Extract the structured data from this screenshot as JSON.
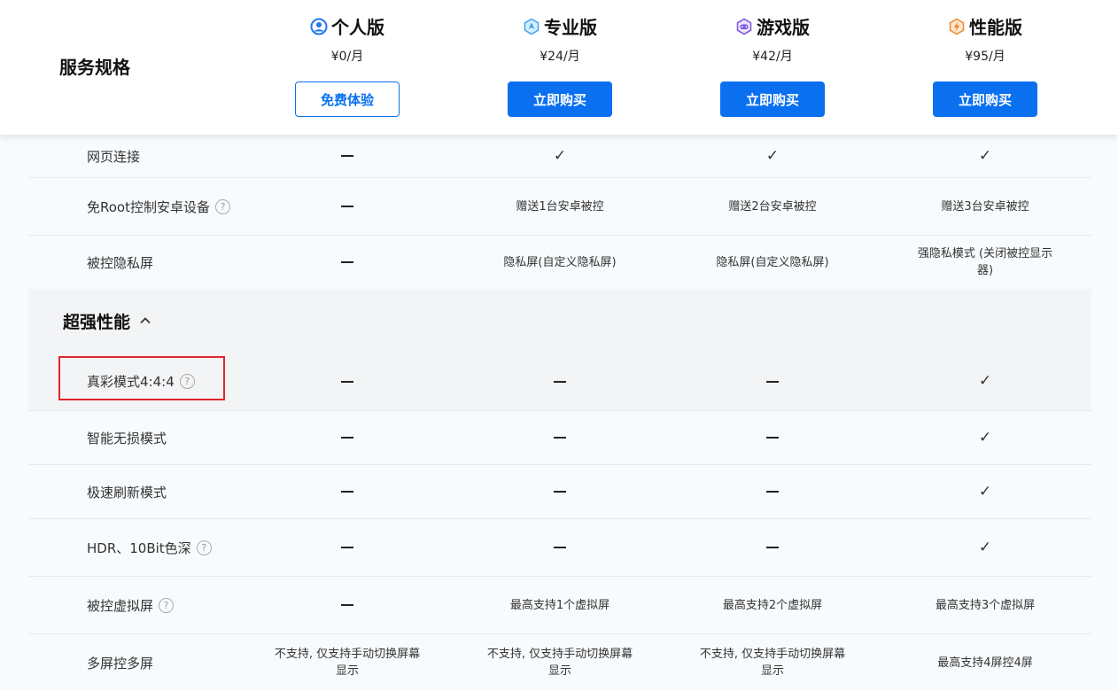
{
  "header": {
    "spec_title": "服务规格",
    "plans": [
      {
        "name": "个人版",
        "price": "¥0/月",
        "button": "免费体验",
        "icon": "user-icon",
        "color": "#1e78f0"
      },
      {
        "name": "专业版",
        "price": "¥24/月",
        "button": "立即购买",
        "icon": "pro-icon",
        "color": "#3aa3f0"
      },
      {
        "name": "游戏版",
        "price": "¥42/月",
        "button": "立即购买",
        "icon": "game-icon",
        "color": "#7b52e0"
      },
      {
        "name": "性能版",
        "price": "¥95/月",
        "button": "立即购买",
        "icon": "bolt-icon",
        "color": "#f08a2c"
      }
    ]
  },
  "rows_top": [
    {
      "label": "网页连接",
      "cells": [
        "—",
        "✓",
        "✓",
        "✓"
      ],
      "help": false
    },
    {
      "label": "免Root控制安卓设备",
      "cells": [
        "—",
        "赠送1台安卓被控",
        "赠送2台安卓被控",
        "赠送3台安卓被控"
      ],
      "help": true
    },
    {
      "label": "被控隐私屏",
      "cells": [
        "—",
        "隐私屏(自定义隐私屏)",
        "隐私屏(自定义隐私屏)",
        "强隐私模式 (关闭被控显示器)"
      ],
      "help": false
    }
  ],
  "section": {
    "title": "超强性能"
  },
  "rows_bottom": [
    {
      "label": "真彩模式4:4:4",
      "cells": [
        "—",
        "—",
        "—",
        "✓"
      ],
      "help": true
    },
    {
      "label": "智能无损模式",
      "cells": [
        "—",
        "—",
        "—",
        "✓"
      ],
      "help": false
    },
    {
      "label": "极速刷新模式",
      "cells": [
        "—",
        "—",
        "—",
        "✓"
      ],
      "help": false
    },
    {
      "label": "HDR、10Bit色深",
      "cells": [
        "—",
        "—",
        "—",
        "✓"
      ],
      "help": true
    },
    {
      "label": "被控虚拟屏",
      "cells": [
        "—",
        "最高支持1个虚拟屏",
        "最高支持2个虚拟屏",
        "最高支持3个虚拟屏"
      ],
      "help": true
    },
    {
      "label": "多屏控多屏",
      "cells": [
        "不支持, 仅支持手动切换屏幕显示",
        "不支持, 仅支持手动切换屏幕显示",
        "不支持, 仅支持手动切换屏幕显示",
        "最高支持4屏控4屏"
      ],
      "help": false
    }
  ],
  "help_glyph": "?",
  "colors": {
    "accent": "#0a70f0",
    "highlight_border": "#e0262a"
  }
}
